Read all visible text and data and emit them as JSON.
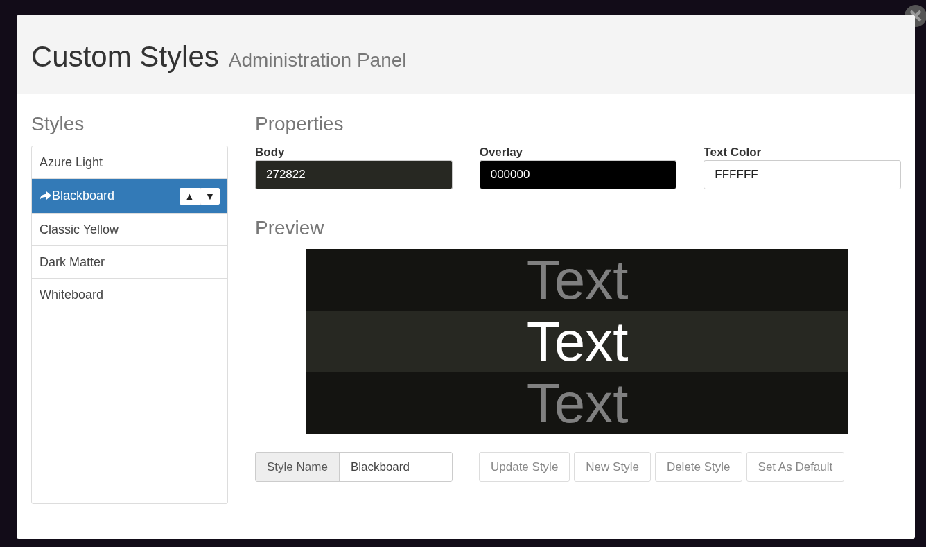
{
  "dialog": {
    "title": "Custom Styles",
    "subtitle": "Administration Panel"
  },
  "styles": {
    "heading": "Styles",
    "items": [
      {
        "label": "Azure Light",
        "selected": false
      },
      {
        "label": "Blackboard",
        "selected": true,
        "move_up": "▲",
        "move_down": "▼"
      },
      {
        "label": "Classic Yellow",
        "selected": false
      },
      {
        "label": "Dark Matter",
        "selected": false
      },
      {
        "label": "Whiteboard",
        "selected": false
      }
    ]
  },
  "properties": {
    "heading": "Properties",
    "fields": [
      {
        "label": "Body",
        "value": "272822"
      },
      {
        "label": "Overlay",
        "value": "000000"
      },
      {
        "label": "Text Color",
        "value": "FFFFFF"
      }
    ]
  },
  "preview": {
    "heading": "Preview",
    "rows": [
      {
        "text": "Text",
        "kind": "overlaid"
      },
      {
        "text": "Text",
        "kind": "focus"
      },
      {
        "text": "Text",
        "kind": "overlaid"
      }
    ]
  },
  "style_name": {
    "label": "Style Name",
    "value": "Blackboard"
  },
  "buttons": [
    {
      "label": "Update Style",
      "disabled": true
    },
    {
      "label": "New Style",
      "disabled": true
    },
    {
      "label": "Delete Style",
      "disabled": true
    },
    {
      "label": "Set As Default",
      "disabled": true
    }
  ]
}
